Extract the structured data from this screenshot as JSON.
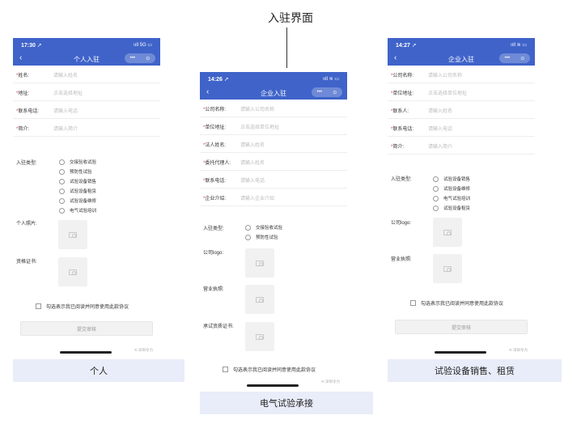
{
  "page_title": "入驻界面",
  "captions": {
    "personal": "个人",
    "electrical": "电气试验承接",
    "equipment": "试验设备销售、租赁"
  },
  "colors": {
    "primary": "#3f63c9",
    "caption_bg": "#e9edf9",
    "required": "#e33333"
  },
  "phone_personal": {
    "status_time": "17:30 ➚",
    "status_icons": "ııll 5G ▭",
    "nav_back": "‹",
    "nav_title": "个人入驻",
    "capsule_dots": "•••",
    "capsule_target": "⊙",
    "fields": [
      {
        "label": "姓名:",
        "placeholder": "请输入姓名"
      },
      {
        "label": "地址:",
        "placeholder": "点击选择地址"
      },
      {
        "label": "联系电话:",
        "placeholder": "请输入电话"
      },
      {
        "label": "简介:",
        "placeholder": "请输入简介"
      }
    ],
    "type_label": "入驻类型:",
    "types": [
      "交接验收试验",
      "预防性试验",
      "试验设备销售",
      "试验设备租赁",
      "试验设备维修",
      "电气试验培训"
    ],
    "photo_label": "个人照片:",
    "cert_label": "资格证书:",
    "agree_text": "勾选表示我已阅读并同意使用此款协议",
    "submit_label": "提交审核",
    "tech_text": "⟲ 深圳令力"
  },
  "phone_electrical": {
    "status_time": "14:26 ➚",
    "status_icons": "ııll ≋ ▭",
    "nav_back": "‹",
    "nav_title": "企业入驻",
    "capsule_dots": "•••",
    "capsule_target": "⊙",
    "fields": [
      {
        "label": "公司名称:",
        "placeholder": "请输入公司名称"
      },
      {
        "label": "单位地址:",
        "placeholder": "点击选择单位地址"
      },
      {
        "label": "法人姓名:",
        "placeholder": "请输入姓名"
      },
      {
        "label": "委托代理人:",
        "placeholder": "请输入姓名"
      },
      {
        "label": "联系电话:",
        "placeholder": "请输入电话"
      },
      {
        "label": "企业介绍:",
        "placeholder": "请输入企业介绍"
      }
    ],
    "type_label": "入驻类型:",
    "types": [
      "交接验收试验",
      "预防性试验"
    ],
    "logo_label": "公司logo:",
    "license_label": "营业执照:",
    "qual_label": "承试资质证书:",
    "agree_text": "勾选表示我已阅读并同意使用此款协议",
    "tech_text": "⟲ 深圳令力"
  },
  "phone_equipment": {
    "status_time": "14:27 ➚",
    "status_icons": "ııll ≋ ▭",
    "nav_back": "‹",
    "nav_title": "企业入驻",
    "capsule_dots": "•••",
    "capsule_target": "⊙",
    "fields": [
      {
        "label": "公司名称:",
        "placeholder": "请输入公司名称"
      },
      {
        "label": "单位地址:",
        "placeholder": "点击选择单位地址"
      },
      {
        "label": "联系人:",
        "placeholder": "请输入姓名"
      },
      {
        "label": "联系电话:",
        "placeholder": "请输入电话"
      },
      {
        "label": "简介:",
        "placeholder": "请输入简介"
      }
    ],
    "type_label": "入驻类型:",
    "types": [
      "试验设备销售",
      "试验设备维修",
      "电气试验培训",
      "试验设备租赁"
    ],
    "logo_label": "公司logo:",
    "license_label": "营业执照:",
    "agree_text": "勾选表示我已阅读并同意使用此款协议",
    "submit_label": "提交审核",
    "tech_text": "⟲ 深圳令力"
  }
}
